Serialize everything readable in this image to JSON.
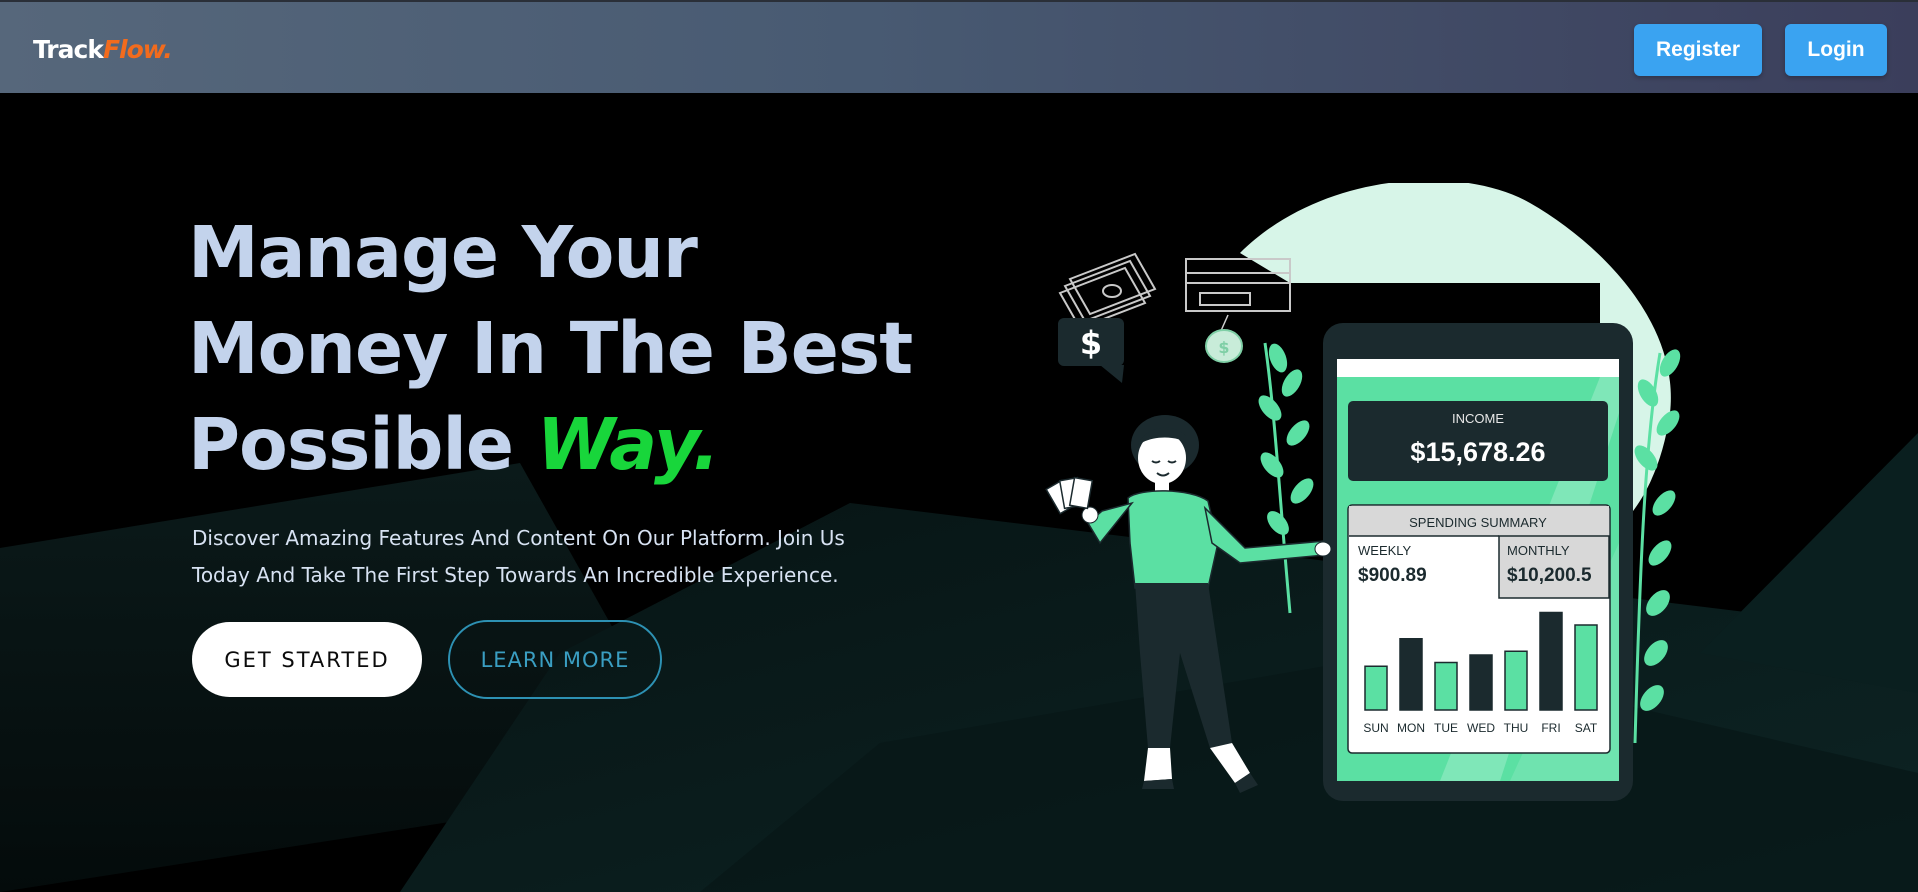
{
  "brand": {
    "part1": "Track",
    "part2": "Flow."
  },
  "nav": {
    "register_label": "Register",
    "login_label": "Login"
  },
  "hero": {
    "headline_line1": "Manage Your",
    "headline_line2": "Money In The Best",
    "headline_line3": "Possible",
    "headline_accent": "Way.",
    "subtitle_line1": "Discover Amazing Features And Content On Our Platform. Join Us",
    "subtitle_line2": "Today And Take The First Step Towards An Incredible Experience.",
    "get_started_label": "GET STARTED",
    "learn_more_label": "LEARN MORE"
  },
  "phone": {
    "income_label": "INCOME",
    "income_value": "$15,678.26",
    "summary_title": "SPENDING SUMMARY",
    "weekly_label": "WEEKLY",
    "weekly_value": "$900.89",
    "monthly_label": "MONTHLY",
    "monthly_value": "$10,200.5",
    "dollar_sign": "$"
  },
  "chart_data": {
    "type": "bar",
    "categories": [
      "SUN",
      "MON",
      "TUE",
      "WED",
      "THU",
      "FRI",
      "SAT"
    ],
    "values": [
      35,
      57,
      38,
      44,
      47,
      78,
      68
    ]
  },
  "colors": {
    "accent_green": "#18d63b",
    "brand_orange": "#f26b1d",
    "nav_button_blue": "#3aa3f1",
    "mint": "#5be0a3",
    "dark_teal": "#1b2a2e"
  }
}
